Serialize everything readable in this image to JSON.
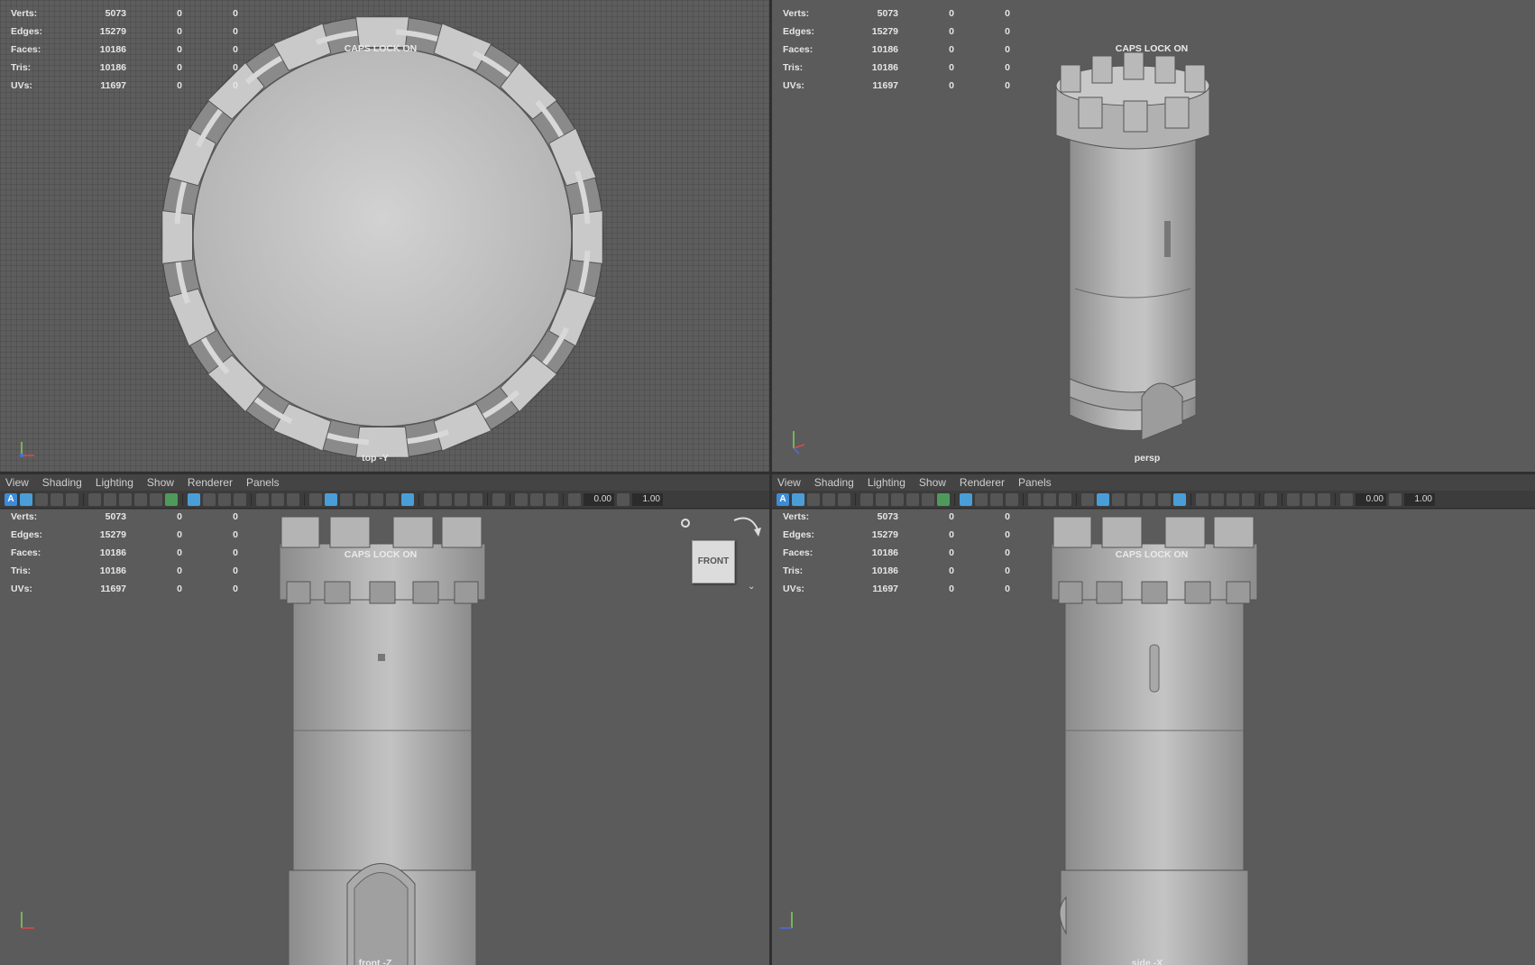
{
  "stats": {
    "rows": [
      {
        "label": "Verts:",
        "value": "5073",
        "sel": "0",
        "extra": "0"
      },
      {
        "label": "Edges:",
        "value": "15279",
        "sel": "0",
        "extra": "0"
      },
      {
        "label": "Faces:",
        "value": "10186",
        "sel": "0",
        "extra": "0"
      },
      {
        "label": "Tris:",
        "value": "10186",
        "sel": "0",
        "extra": "0"
      },
      {
        "label": "UVs:",
        "value": "11697",
        "sel": "0",
        "extra": "0"
      }
    ]
  },
  "caps_text": "CAPS LOCK ON",
  "panel_menu": {
    "view": "View",
    "shading": "Shading",
    "lighting": "Lighting",
    "show": "Show",
    "renderer": "Renderer",
    "panels": "Panels"
  },
  "toolbar": {
    "a_label": "A",
    "field1": "0.00",
    "field2": "1.00"
  },
  "viewports": {
    "top": {
      "camera": "top -Y"
    },
    "persp": {
      "camera": "persp"
    },
    "front": {
      "camera": "front -Z"
    },
    "side": {
      "camera": "side -X"
    }
  },
  "viewcube": {
    "face": "FRONT"
  },
  "axis_labels": {
    "x": "x",
    "y": "y",
    "z": "z"
  },
  "colors": {
    "viewport_bg": "#5b5b5b",
    "model_gray": "#b5b5b5",
    "accent_blue": "#3d8bd6"
  }
}
